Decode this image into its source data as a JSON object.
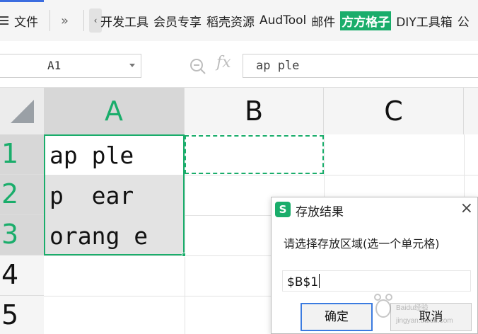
{
  "menu": {
    "file_label": "文件",
    "more": "»",
    "scroll_left": "‹",
    "items": [
      "开发工具",
      "会员专享",
      "稻壳资源",
      "AudTool",
      "邮件"
    ],
    "highlight_item": "方方格子",
    "items_after": [
      "DIY工具箱",
      "公"
    ]
  },
  "formula_bar": {
    "cell_ref": "A1",
    "fx": "fx",
    "content": "ap ple"
  },
  "grid": {
    "columns": [
      "A",
      "B",
      "C"
    ],
    "rows": [
      "1",
      "2",
      "3",
      "4",
      "5"
    ],
    "cells": [
      "ap ple",
      "p  ear",
      "orang e"
    ]
  },
  "dialog": {
    "logo": "S",
    "title": "存放结果",
    "close": "×",
    "prompt": "请选择存放区域(选一个单元格)",
    "value": "$B$1",
    "ok": "确定",
    "cancel": "取消"
  },
  "watermark": {
    "brand": "Baidu经验",
    "url": "jingyan.baidu.com"
  },
  "colors": {
    "accent_green": "#1aad6b",
    "focus_blue": "#3b7be0"
  }
}
